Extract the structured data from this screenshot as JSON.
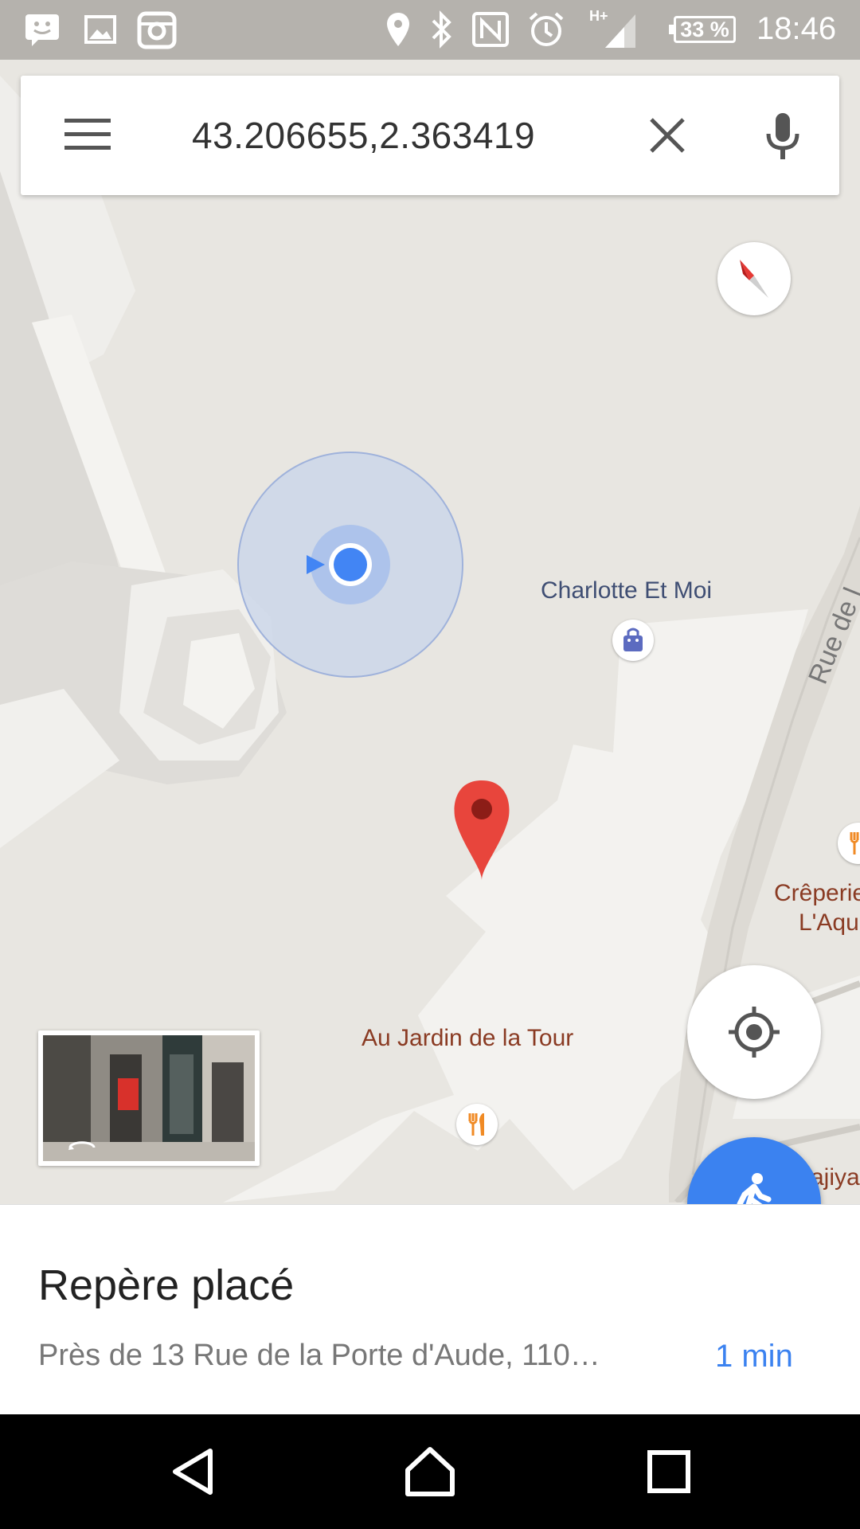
{
  "status_bar": {
    "time": "18:46",
    "battery": "33 %",
    "icons": [
      "chat-notification-icon",
      "gallery-icon",
      "instagram-icon",
      "location-icon",
      "bluetooth-icon",
      "nfc-icon",
      "alarm-icon",
      "signal-hplus-icon",
      "battery-icon"
    ]
  },
  "search": {
    "query": "43.206655,2.363419",
    "menu_icon": "hamburger-menu-icon",
    "clear_icon": "close-icon",
    "voice_icon": "microphone-icon"
  },
  "map": {
    "labels": {
      "charlotte": "Charlotte Et Moi",
      "jardin": "Au Jardin de la Tour",
      "creperie_line1": "Crêperie",
      "creperie_line2": "L'Aqu",
      "hajiya": "ajiya",
      "street": "Rue de l"
    },
    "poi_icons": [
      "shopping-bag-icon",
      "restaurant-icon"
    ],
    "colors": {
      "background": "#e8e6e1",
      "my_location": "#4285f4",
      "dropped_pin": "#e8453c",
      "shop_label": "#3f4e73",
      "food_label": "#8a3b23"
    }
  },
  "bottom_sheet": {
    "title": "Repère placé",
    "address": "Près de 13 Rue de la Porte d'Aude, 110…",
    "travel_time": "1 min"
  },
  "nav_bar": {
    "icons": [
      "back-icon",
      "home-icon",
      "recents-icon"
    ]
  }
}
